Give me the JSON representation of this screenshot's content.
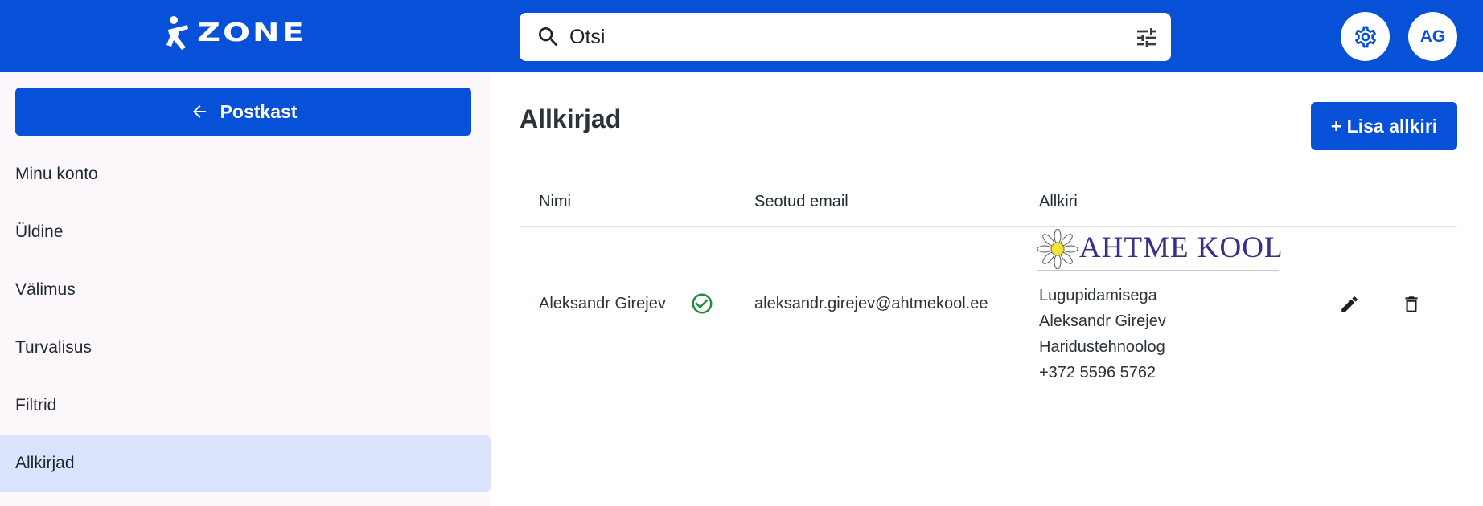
{
  "app": {
    "logo_text": "ZONE",
    "brand_color": "#0750d8"
  },
  "search": {
    "placeholder": "Otsi",
    "value": ""
  },
  "header": {
    "avatar_initials": "AG"
  },
  "sidebar": {
    "back_label": "Postkast",
    "items": [
      {
        "label": "Minu konto"
      },
      {
        "label": "Üldine"
      },
      {
        "label": "Välimus"
      },
      {
        "label": "Turvalisus"
      },
      {
        "label": "Filtrid"
      },
      {
        "label": "Allkirjad",
        "active": true
      }
    ]
  },
  "main": {
    "title": "Allkirjad",
    "add_label": "+ Lisa allkiri",
    "columns": [
      "Nimi",
      "Seotud email",
      "Allkiri"
    ],
    "rows": [
      {
        "name": "Aleksandr Girejev",
        "verified": true,
        "email": "aleksandr.girejev@ahtmekool.ee",
        "signature": {
          "logo_text": "AHTME KOOL",
          "lines": [
            "Lugupidamisega",
            "Aleksandr Girejev",
            "Haridustehnoolog",
            "+372 5596 5762"
          ]
        }
      }
    ]
  },
  "icons": [
    "runner-logo-icon",
    "search-icon",
    "tune-icon",
    "gear-icon",
    "arrow-left-icon",
    "check-circle-icon",
    "daisy-icon",
    "pencil-icon",
    "trash-icon"
  ]
}
